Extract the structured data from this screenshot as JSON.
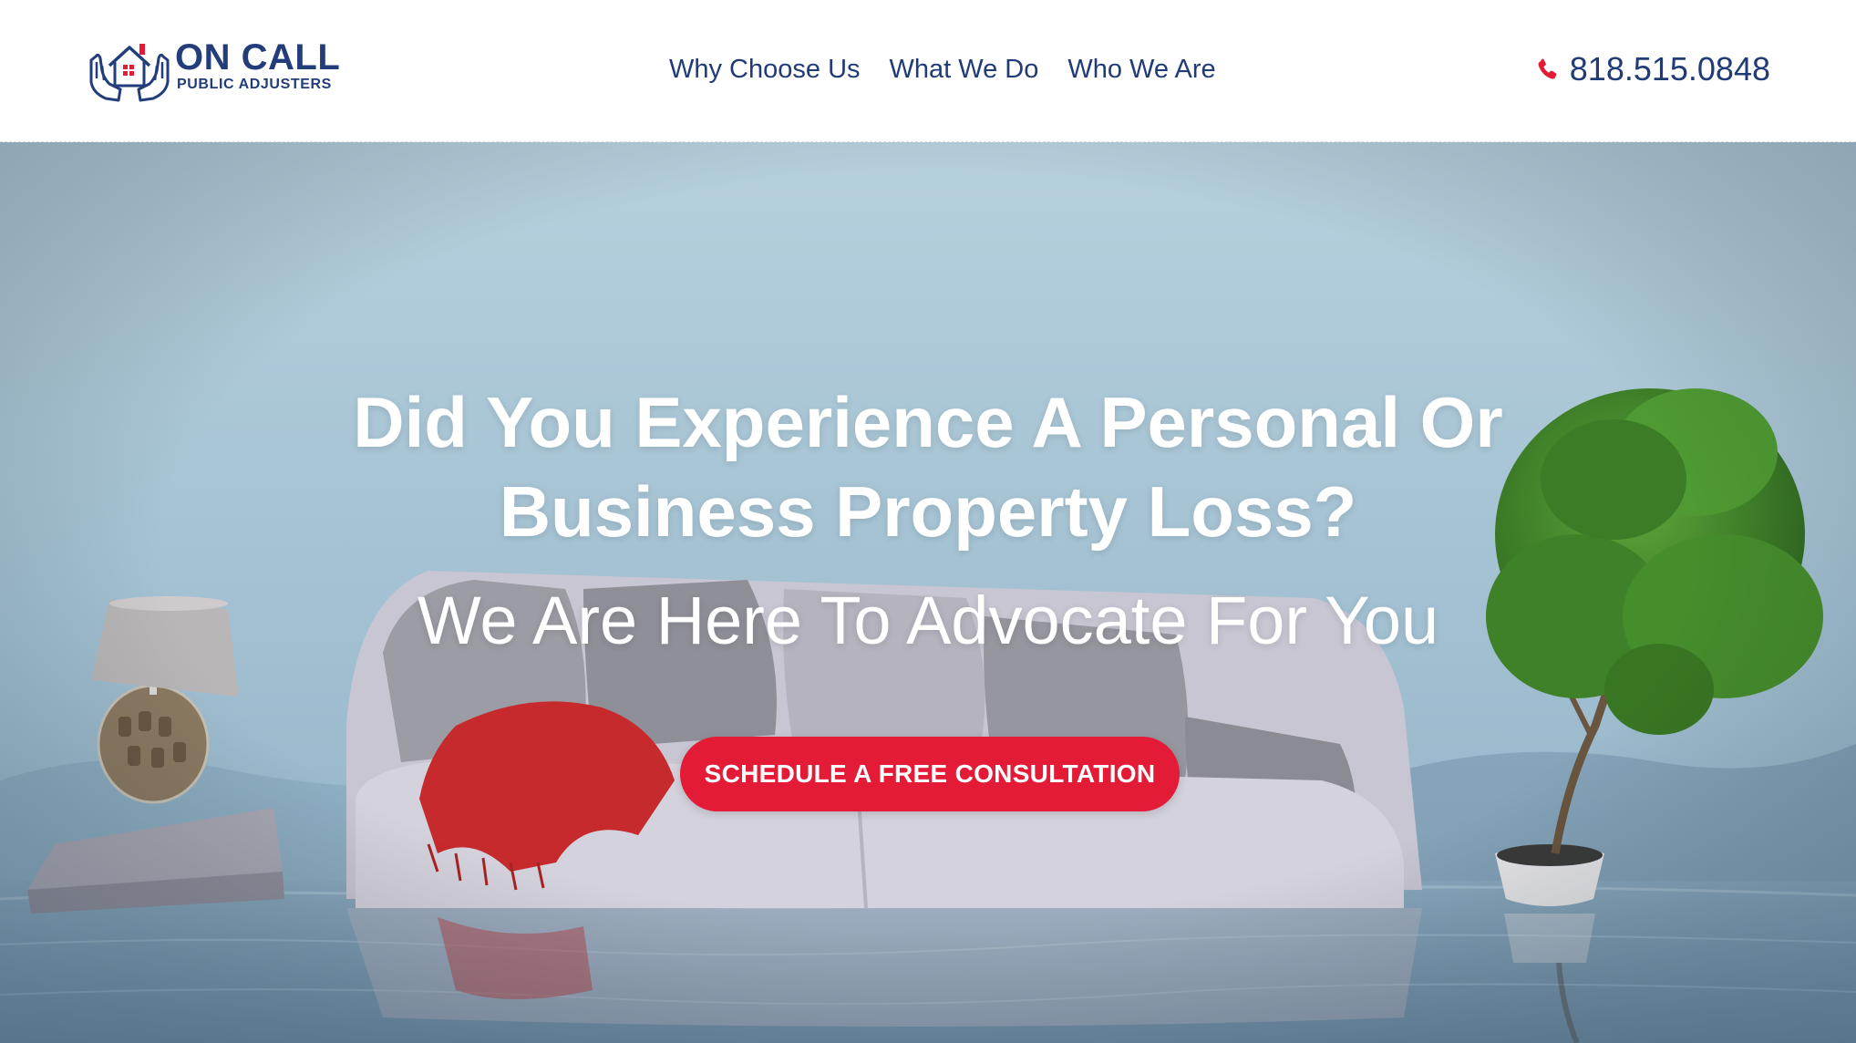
{
  "header": {
    "logo": {
      "main_text": "ON CALL",
      "sub_text": "PUBLIC ADJUSTERS"
    },
    "nav": [
      {
        "label": "Why Choose Us"
      },
      {
        "label": "What We Do"
      },
      {
        "label": "Who We Are"
      }
    ],
    "phone": {
      "icon": "phone-icon",
      "number": "818.515.0848"
    }
  },
  "hero": {
    "heading": "Did You Experience A Personal Or Business Property Loss?",
    "subheading": "We Are Here To Advocate For You",
    "cta_label": "SCHEDULE A FREE CONSULTATION"
  },
  "colors": {
    "brand_navy": "#213b77",
    "accent_red": "#e31b36",
    "hero_sky": "#a9c6d6"
  }
}
